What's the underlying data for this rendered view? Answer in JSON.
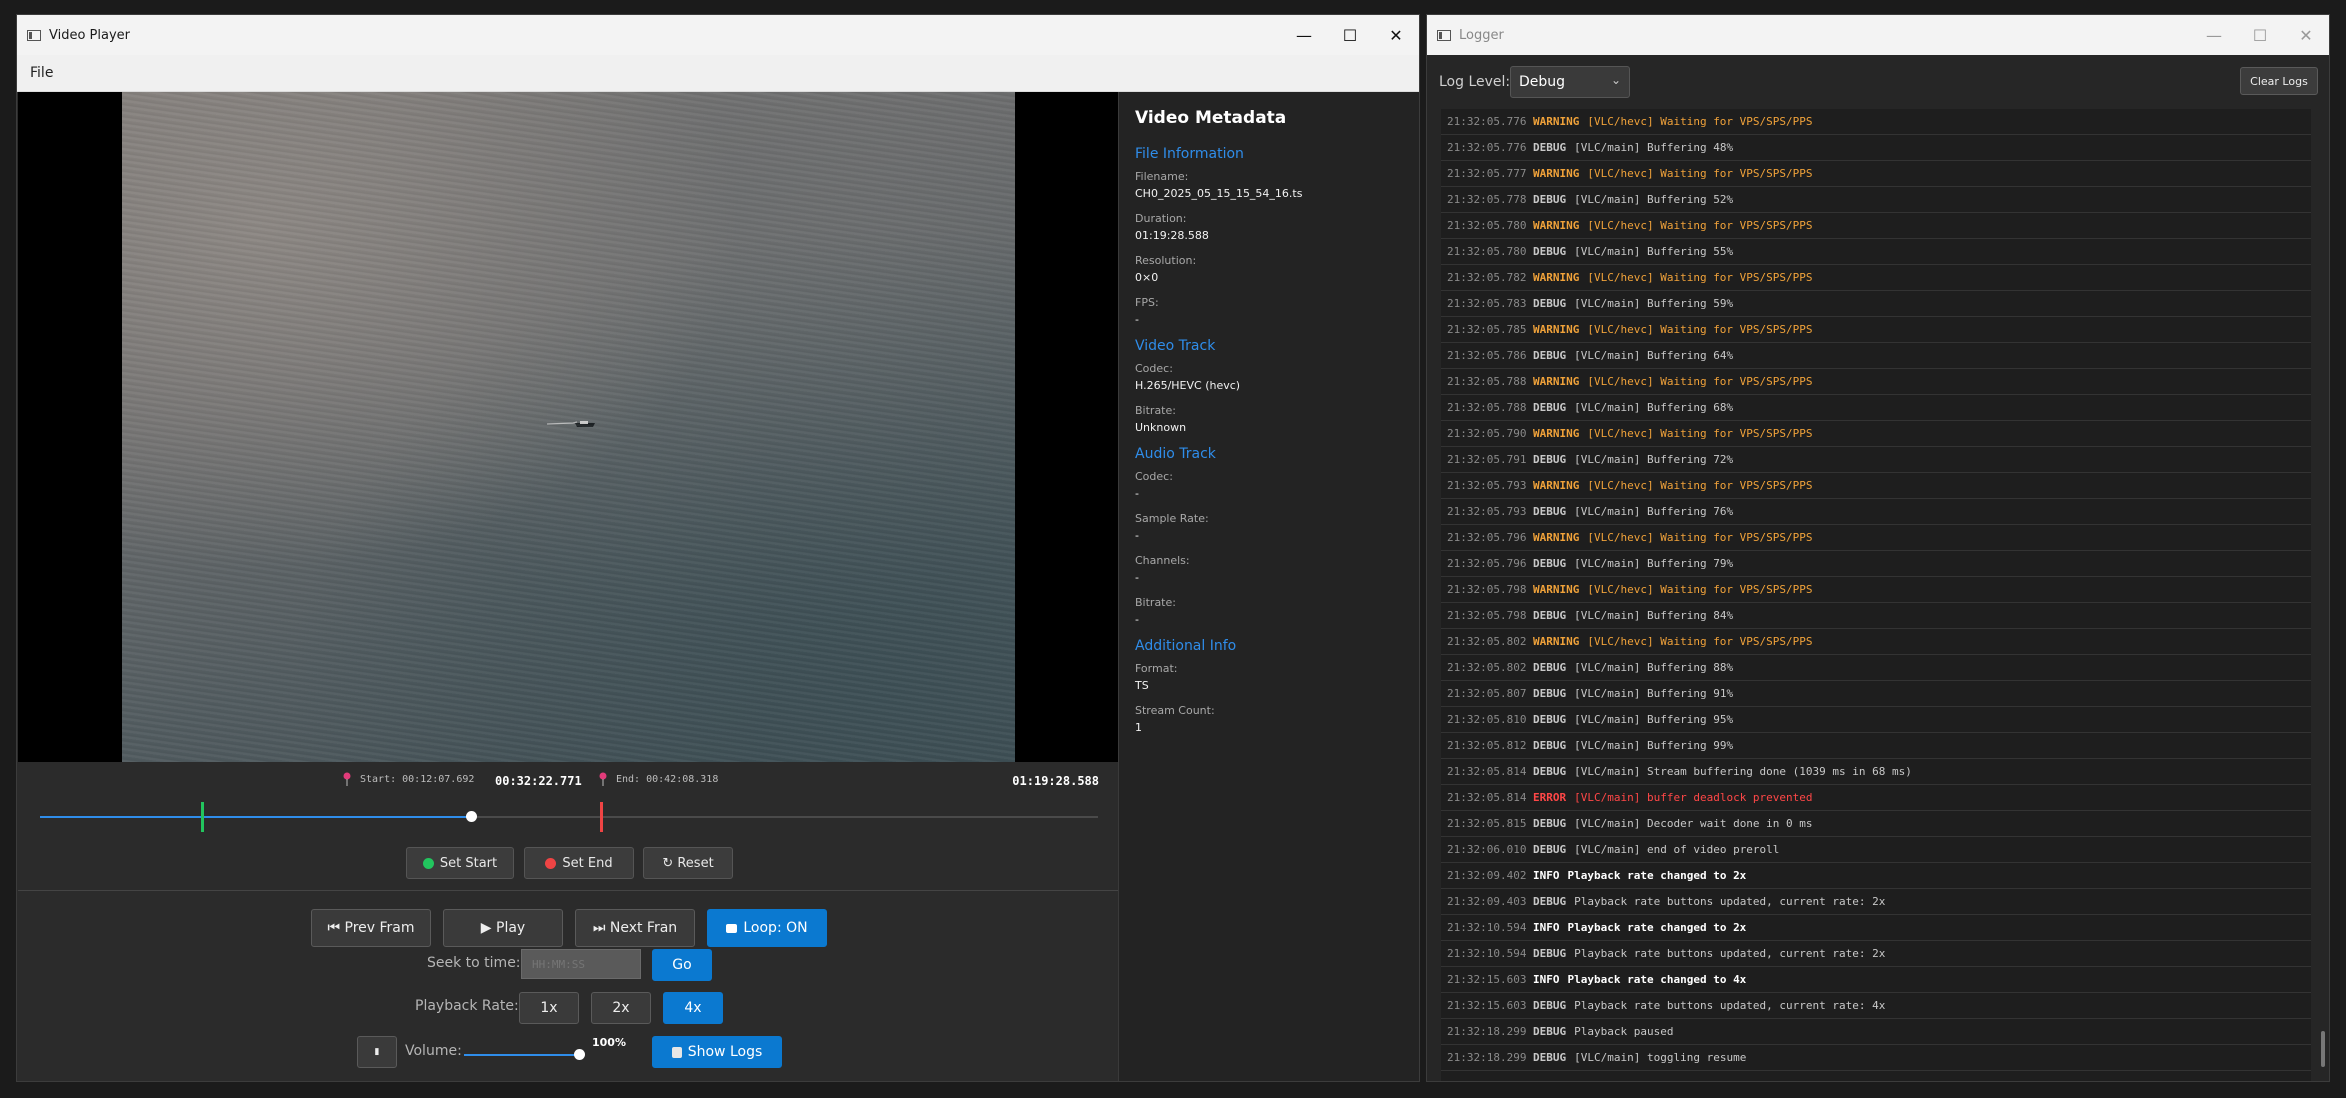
{
  "player": {
    "window_title": "Video Player",
    "menu": {
      "file": "File"
    },
    "metadata": {
      "heading": "Video Metadata",
      "file_info": {
        "heading": "File Information",
        "filename_label": "Filename:",
        "filename": "CH0_2025_05_15_15_54_16.ts",
        "duration_label": "Duration:",
        "duration": "01:19:28.588",
        "resolution_label": "Resolution:",
        "resolution": "0×0",
        "fps_label": "FPS:",
        "fps": "-"
      },
      "video_track": {
        "heading": "Video Track",
        "codec_label": "Codec:",
        "codec": "H.265/HEVC (hevc)",
        "bitrate_label": "Bitrate:",
        "bitrate": "Unknown"
      },
      "audio_track": {
        "heading": "Audio Track",
        "codec_label": "Codec:",
        "codec": "-",
        "sample_rate_label": "Sample Rate:",
        "sample_rate": "-",
        "channels_label": "Channels:",
        "channels": "-",
        "bitrate_label": "Bitrate:",
        "bitrate": "-"
      },
      "additional": {
        "heading": "Additional Info",
        "format_label": "Format:",
        "format": "TS",
        "stream_count_label": "Stream Count:",
        "stream_count": "1"
      }
    },
    "timeline": {
      "start_label": "Start: 00:12:07.692",
      "end_label": "End: 00:42:08.318",
      "current_time": "00:32:22.771",
      "total_time": "01:19:28.588",
      "progress_fraction": 0.407,
      "start_fraction": 0.153,
      "end_fraction": 0.53,
      "set_start": "Set Start",
      "set_end": "Set End",
      "reset": "↻ Reset"
    },
    "controls": {
      "prev_frame": "⏮ Prev Fram",
      "play": "▶ Play",
      "next_frame": "⏭ Next Fran",
      "loop": "Loop: ON",
      "seek_label": "Seek to time:",
      "seek_placeholder": "HH:MM:SS",
      "go": "Go",
      "rate_label": "Playback Rate:",
      "rate_1x": "1x",
      "rate_2x": "2x",
      "rate_4x": "4x",
      "mute_glyph": "▮",
      "volume_label": "Volume:",
      "volume_value": "100%",
      "volume_fraction": 1.0,
      "show_logs": "Show Logs"
    },
    "colors": {
      "accent": "#0b79d0",
      "start_marker": "#22c55e",
      "end_marker": "#ef4444"
    }
  },
  "logger": {
    "window_title": "Logger",
    "log_level_label": "Log Level:",
    "log_level_value": "Debug",
    "clear_button": "Clear Logs",
    "entries": [
      {
        "ts": "21:32:05.776",
        "level": "WARNING",
        "msg": "[VLC/hevc] Waiting for VPS/SPS/PPS"
      },
      {
        "ts": "21:32:05.776",
        "level": "DEBUG",
        "msg": "[VLC/main] Buffering 48%"
      },
      {
        "ts": "21:32:05.777",
        "level": "WARNING",
        "msg": "[VLC/hevc] Waiting for VPS/SPS/PPS"
      },
      {
        "ts": "21:32:05.778",
        "level": "DEBUG",
        "msg": "[VLC/main] Buffering 52%"
      },
      {
        "ts": "21:32:05.780",
        "level": "WARNING",
        "msg": "[VLC/hevc] Waiting for VPS/SPS/PPS"
      },
      {
        "ts": "21:32:05.780",
        "level": "DEBUG",
        "msg": "[VLC/main] Buffering 55%"
      },
      {
        "ts": "21:32:05.782",
        "level": "WARNING",
        "msg": "[VLC/hevc] Waiting for VPS/SPS/PPS"
      },
      {
        "ts": "21:32:05.783",
        "level": "DEBUG",
        "msg": "[VLC/main] Buffering 59%"
      },
      {
        "ts": "21:32:05.785",
        "level": "WARNING",
        "msg": "[VLC/hevc] Waiting for VPS/SPS/PPS"
      },
      {
        "ts": "21:32:05.786",
        "level": "DEBUG",
        "msg": "[VLC/main] Buffering 64%"
      },
      {
        "ts": "21:32:05.788",
        "level": "WARNING",
        "msg": "[VLC/hevc] Waiting for VPS/SPS/PPS"
      },
      {
        "ts": "21:32:05.788",
        "level": "DEBUG",
        "msg": "[VLC/main] Buffering 68%"
      },
      {
        "ts": "21:32:05.790",
        "level": "WARNING",
        "msg": "[VLC/hevc] Waiting for VPS/SPS/PPS"
      },
      {
        "ts": "21:32:05.791",
        "level": "DEBUG",
        "msg": "[VLC/main] Buffering 72%"
      },
      {
        "ts": "21:32:05.793",
        "level": "WARNING",
        "msg": "[VLC/hevc] Waiting for VPS/SPS/PPS"
      },
      {
        "ts": "21:32:05.793",
        "level": "DEBUG",
        "msg": "[VLC/main] Buffering 76%"
      },
      {
        "ts": "21:32:05.796",
        "level": "WARNING",
        "msg": "[VLC/hevc] Waiting for VPS/SPS/PPS"
      },
      {
        "ts": "21:32:05.796",
        "level": "DEBUG",
        "msg": "[VLC/main] Buffering 79%"
      },
      {
        "ts": "21:32:05.798",
        "level": "WARNING",
        "msg": "[VLC/hevc] Waiting for VPS/SPS/PPS"
      },
      {
        "ts": "21:32:05.798",
        "level": "DEBUG",
        "msg": "[VLC/main] Buffering 84%"
      },
      {
        "ts": "21:32:05.802",
        "level": "WARNING",
        "msg": "[VLC/hevc] Waiting for VPS/SPS/PPS"
      },
      {
        "ts": "21:32:05.802",
        "level": "DEBUG",
        "msg": "[VLC/main] Buffering 88%"
      },
      {
        "ts": "21:32:05.807",
        "level": "DEBUG",
        "msg": "[VLC/main] Buffering 91%"
      },
      {
        "ts": "21:32:05.810",
        "level": "DEBUG",
        "msg": "[VLC/main] Buffering 95%"
      },
      {
        "ts": "21:32:05.812",
        "level": "DEBUG",
        "msg": "[VLC/main] Buffering 99%"
      },
      {
        "ts": "21:32:05.814",
        "level": "DEBUG",
        "msg": "[VLC/main] Stream buffering done (1039 ms in 68 ms)"
      },
      {
        "ts": "21:32:05.814",
        "level": "ERROR",
        "msg": "[VLC/main] buffer deadlock prevented"
      },
      {
        "ts": "21:32:05.815",
        "level": "DEBUG",
        "msg": "[VLC/main] Decoder wait done in 0 ms"
      },
      {
        "ts": "21:32:06.010",
        "level": "DEBUG",
        "msg": "[VLC/main] end of video preroll"
      },
      {
        "ts": "21:32:09.402",
        "level": "INFO",
        "msg": "Playback rate changed to 2x"
      },
      {
        "ts": "21:32:09.403",
        "level": "DEBUG",
        "msg": "Playback rate buttons updated, current rate: 2x"
      },
      {
        "ts": "21:32:10.594",
        "level": "INFO",
        "msg": "Playback rate changed to 2x"
      },
      {
        "ts": "21:32:10.594",
        "level": "DEBUG",
        "msg": "Playback rate buttons updated, current rate: 2x"
      },
      {
        "ts": "21:32:15.603",
        "level": "INFO",
        "msg": "Playback rate changed to 4x"
      },
      {
        "ts": "21:32:15.603",
        "level": "DEBUG",
        "msg": "Playback rate buttons updated, current rate: 4x"
      },
      {
        "ts": "21:32:18.299",
        "level": "DEBUG",
        "msg": "Playback paused"
      },
      {
        "ts": "21:32:18.299",
        "level": "DEBUG",
        "msg": "[VLC/main] toggling resume"
      }
    ]
  }
}
